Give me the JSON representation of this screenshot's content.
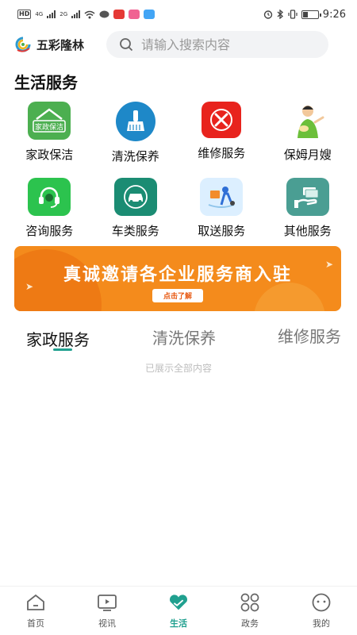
{
  "status_bar": {
    "net_label": "HD",
    "net1": "4G",
    "net2": "2G",
    "time": "9:26",
    "battery_level": 0.35,
    "icons": [
      "signal-icon",
      "wifi-icon",
      "message-icon",
      "app-badge-icon",
      "mail-icon",
      "alarm-icon",
      "bluetooth-icon",
      "vibrate-icon",
      "battery-icon"
    ]
  },
  "header": {
    "app_name": "五彩隆林",
    "search_placeholder": "请输入搜索内容"
  },
  "section_title": "生活服务",
  "services": [
    {
      "label": "家政保洁",
      "icon": "housekeeping-icon",
      "icon_text": "家政保洁",
      "color": "#4caf50"
    },
    {
      "label": "清洗保养",
      "icon": "cleaning-brush-icon",
      "color": "#1e88c8"
    },
    {
      "label": "维修服务",
      "icon": "repair-tools-icon",
      "color": "#e8231d"
    },
    {
      "label": "保姆月嫂",
      "icon": "nanny-icon",
      "color": "#6cbf3a"
    },
    {
      "label": "咨询服务",
      "icon": "headset-icon",
      "color": "#2cc34e"
    },
    {
      "label": "车类服务",
      "icon": "car-icon",
      "color": "#1b8c73"
    },
    {
      "label": "取送服务",
      "icon": "delivery-icon",
      "color": "#8ec4ea"
    },
    {
      "label": "其他服务",
      "icon": "hand-cash-icon",
      "color": "#4a9e93"
    }
  ],
  "banner": {
    "title": "真诚邀请各企业服务商入驻",
    "button": "点击了解"
  },
  "tabs": [
    {
      "label": "家政服务",
      "active": true
    },
    {
      "label": "清洗保养",
      "active": false
    },
    {
      "label": "维修服务",
      "active": false
    }
  ],
  "empty_note": "已展示全部内容",
  "bottom_nav": [
    {
      "label": "首页",
      "icon": "home-icon",
      "active": false
    },
    {
      "label": "视讯",
      "icon": "video-icon",
      "active": false
    },
    {
      "label": "生活",
      "icon": "heart-hands-icon",
      "active": true
    },
    {
      "label": "政务",
      "icon": "grid-icon",
      "active": false
    },
    {
      "label": "我的",
      "icon": "profile-icon",
      "active": false
    }
  ],
  "colors": {
    "accent": "#20a08f",
    "banner": "#f48b1c"
  }
}
